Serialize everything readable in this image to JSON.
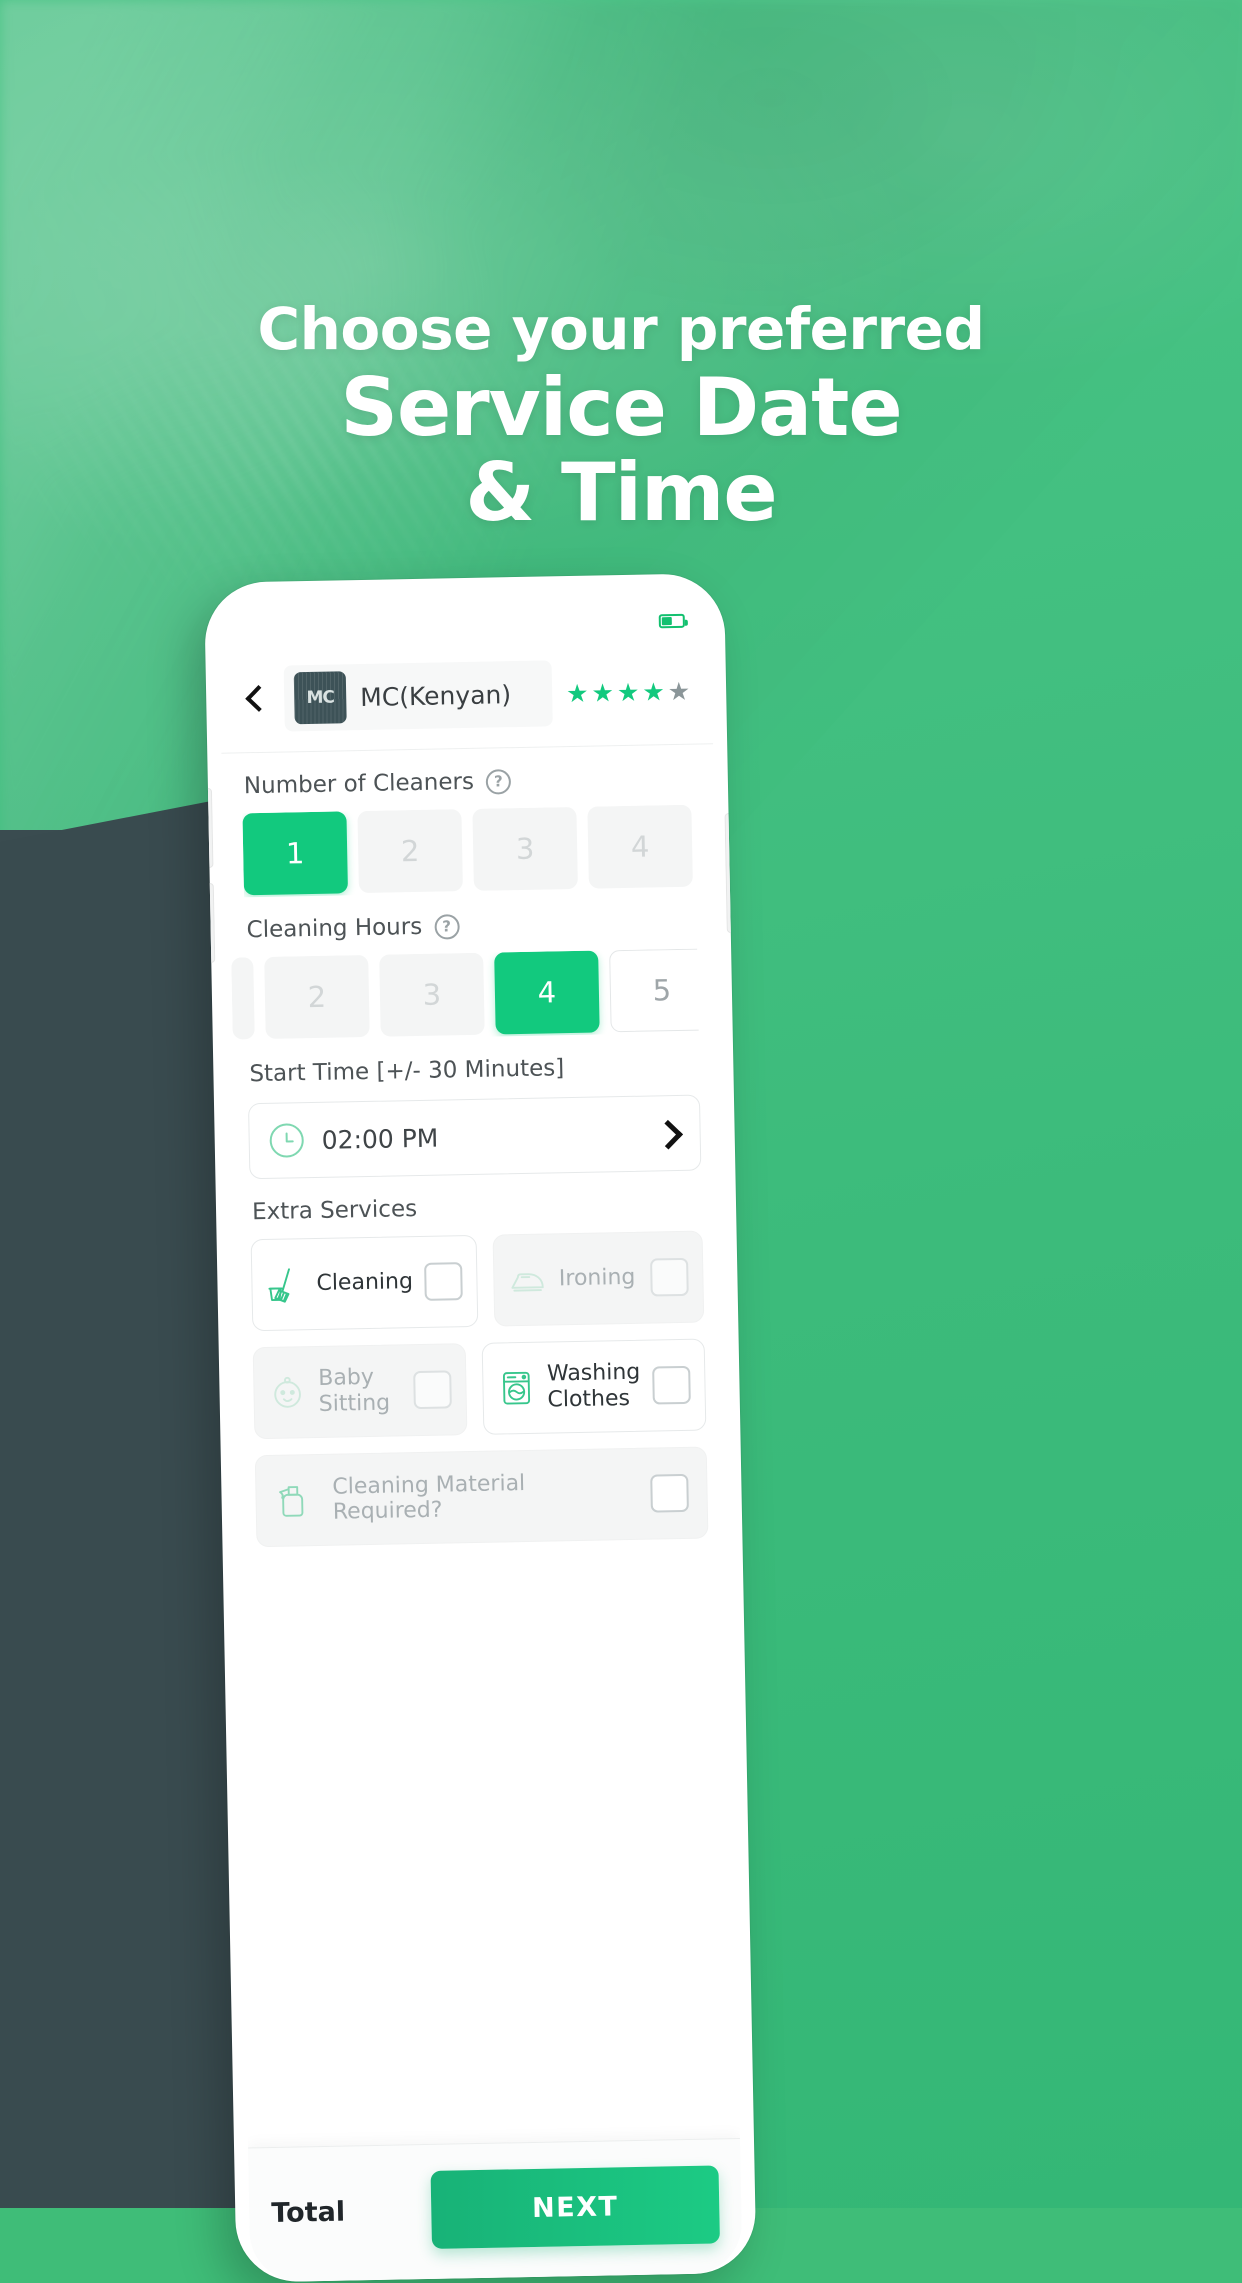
{
  "promo": {
    "headline_line1": "Choose your preferred",
    "headline_line2": "Service Date",
    "headline_line3": "& Time",
    "accent_color": "#12c97e",
    "background_color": "#3fbd78",
    "wedge_color": "#394b4f"
  },
  "app": {
    "header": {
      "back_icon": "chevron-left-icon",
      "avatar_mark": "MC",
      "provider_name": "MC(Kenyan)",
      "rating_filled": 4,
      "rating_total": 5,
      "star_glyph": "★"
    },
    "status_bar": {
      "battery_icon": "battery-icon"
    },
    "cleaners": {
      "label": "Number of Cleaners",
      "help_glyph": "?",
      "options": [
        {
          "value": "1",
          "state": "active"
        },
        {
          "value": "2",
          "state": "disabled"
        },
        {
          "value": "3",
          "state": "disabled"
        },
        {
          "value": "4",
          "state": "disabled"
        }
      ]
    },
    "hours": {
      "label": "Cleaning Hours",
      "help_glyph": "?",
      "options": [
        {
          "value": "2",
          "state": "disabled"
        },
        {
          "value": "3",
          "state": "disabled"
        },
        {
          "value": "4",
          "state": "active"
        },
        {
          "value": "5",
          "state": "enabled"
        }
      ]
    },
    "start_time": {
      "label": "Start Time [+/- 30 Minutes]",
      "value": "02:00 PM",
      "clock_icon": "clock-icon",
      "chevron_icon": "chevron-right-icon"
    },
    "extra_services": {
      "label": "Extra Services",
      "items": [
        {
          "name": "Cleaning",
          "icon": "broom-bucket-icon",
          "state": "on",
          "checked": false
        },
        {
          "name": "Ironing",
          "icon": "iron-icon",
          "state": "off",
          "checked": false
        },
        {
          "name": "Baby Sitting",
          "line1": "Baby",
          "line2": "Sitting",
          "icon": "baby-face-icon",
          "state": "off",
          "checked": false
        },
        {
          "name": "Washing Clothes",
          "line1": "Washing",
          "line2": "Clothes",
          "icon": "washing-machine-icon",
          "state": "on",
          "checked": false
        }
      ],
      "material": {
        "label": "Cleaning Material Required?",
        "icon": "spray-bottle-icon",
        "state": "off",
        "checked": false
      }
    },
    "footer": {
      "total_label": "Total",
      "next_label": "NEXT"
    }
  }
}
